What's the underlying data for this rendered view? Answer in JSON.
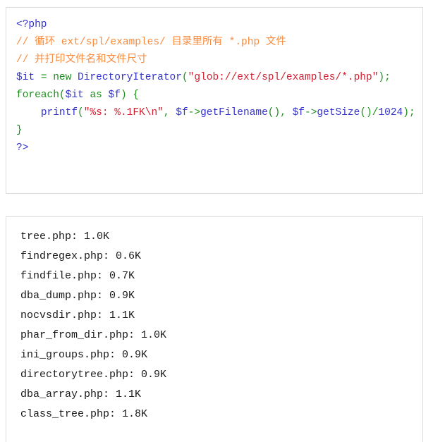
{
  "code_block": {
    "language": "php",
    "lines": [
      {
        "id": "line-open-tag",
        "tokens": [
          {
            "text": "<?php",
            "type": "tag"
          }
        ]
      },
      {
        "id": "line-comment-1",
        "tokens": [
          {
            "text": "// 循环 ext/spl/examples/ 目录里所有 *.php 文件",
            "type": "comment"
          }
        ]
      },
      {
        "id": "line-comment-2",
        "tokens": [
          {
            "text": "// 并打印文件名和文件尺寸",
            "type": "comment"
          }
        ]
      },
      {
        "id": "line-assign-iterator",
        "tokens": [
          {
            "text": "$it",
            "type": "var"
          },
          {
            "text": " ",
            "type": "plain"
          },
          {
            "text": "=",
            "type": "kw"
          },
          {
            "text": " ",
            "type": "plain"
          },
          {
            "text": "new",
            "type": "kw"
          },
          {
            "text": " ",
            "type": "plain"
          },
          {
            "text": "DirectoryIterator",
            "type": "cls"
          },
          {
            "text": "(",
            "type": "punct"
          },
          {
            "text": "\"glob://ext/spl/examples/*.php\"",
            "type": "str"
          },
          {
            "text": ")",
            "type": "punct"
          },
          {
            "text": ";",
            "type": "punct"
          }
        ]
      },
      {
        "id": "line-foreach",
        "tokens": [
          {
            "text": "foreach",
            "type": "kw"
          },
          {
            "text": "(",
            "type": "punct"
          },
          {
            "text": "$it",
            "type": "var"
          },
          {
            "text": " ",
            "type": "plain"
          },
          {
            "text": "as",
            "type": "kw"
          },
          {
            "text": " ",
            "type": "plain"
          },
          {
            "text": "$f",
            "type": "var"
          },
          {
            "text": ")",
            "type": "punct"
          },
          {
            "text": " ",
            "type": "plain"
          },
          {
            "text": "{",
            "type": "punct"
          }
        ]
      },
      {
        "id": "line-printf",
        "tokens": [
          {
            "text": "    ",
            "type": "plain"
          },
          {
            "text": "printf",
            "type": "fn"
          },
          {
            "text": "(",
            "type": "punct"
          },
          {
            "text": "\"%s: %.1FK\\n\"",
            "type": "str"
          },
          {
            "text": ",",
            "type": "punct"
          },
          {
            "text": " ",
            "type": "plain"
          },
          {
            "text": "$f",
            "type": "var"
          },
          {
            "text": "->",
            "type": "punct"
          },
          {
            "text": "getFilename",
            "type": "fn"
          },
          {
            "text": "()",
            "type": "punct"
          },
          {
            "text": ",",
            "type": "punct"
          },
          {
            "text": " ",
            "type": "plain"
          },
          {
            "text": "$f",
            "type": "var"
          },
          {
            "text": "->",
            "type": "punct"
          },
          {
            "text": "getSize",
            "type": "fn"
          },
          {
            "text": "()",
            "type": "punct"
          },
          {
            "text": "/",
            "type": "punct"
          },
          {
            "text": "1024",
            "type": "num"
          },
          {
            "text": ")",
            "type": "punct"
          },
          {
            "text": ";",
            "type": "punct"
          }
        ]
      },
      {
        "id": "line-close-brace",
        "tokens": [
          {
            "text": "}",
            "type": "punct"
          }
        ]
      },
      {
        "id": "line-close-tag",
        "tokens": [
          {
            "text": "?>",
            "type": "tag"
          }
        ]
      }
    ]
  },
  "output_block": {
    "lines": [
      "tree.php: 1.0K",
      "findregex.php: 0.6K",
      "findfile.php: 0.7K",
      "dba_dump.php: 0.9K",
      "nocvsdir.php: 1.1K",
      "phar_from_dir.php: 1.0K",
      "ini_groups.php: 0.9K",
      "directorytree.php: 0.9K",
      "dba_array.php: 1.1K",
      "class_tree.php: 1.8K"
    ]
  },
  "colors": {
    "panel_border": "#dcdcdc",
    "background": "#ffffff",
    "comment": "#F98B3E",
    "string": "#D32030",
    "keyword": "#1E8F1E",
    "variable": "#3333CC",
    "tag": "#3333CC",
    "number": "#3333CC",
    "output_text": "#1a1a1a"
  }
}
